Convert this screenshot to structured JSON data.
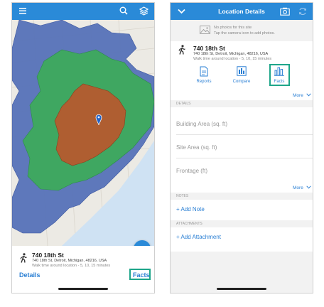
{
  "colors": {
    "accent": "#2a8ad8",
    "highlight": "#1fa68a",
    "link": "#2a7fd4",
    "ring_outer": "#5672b8",
    "ring_middle": "#3daa5c",
    "ring_inner": "#b55a2e",
    "water": "#cfe2f3"
  },
  "left": {
    "appbar": {
      "icons": [
        "menu-icon",
        "search-icon",
        "layers-icon"
      ]
    },
    "fab": {
      "icon": "more-icon"
    },
    "location": {
      "name": "740 18th St",
      "address": "740 18th St, Detroit, Michigan, 48216, USA",
      "walk_time": "Walk time around location - 5, 10, 15 minutes",
      "icon": "walker-icon"
    },
    "links": {
      "details": "Details",
      "facts": "Facts"
    }
  },
  "right": {
    "appbar": {
      "title": "Location Details",
      "icons": [
        "chevron-down-icon",
        "camera-icon",
        "refresh-icon"
      ]
    },
    "photos": {
      "line1": "No photos for this site",
      "line2": "Tap the camera icon to add photos."
    },
    "location": {
      "name": "740 18th St",
      "address": "740 18th St, Detroit, Michigan, 48216, USA",
      "walk_time": "Walk time around location - 5, 10, 15 minutes"
    },
    "actions": [
      {
        "label": "Reports",
        "icon": "document-icon"
      },
      {
        "label": "Compare",
        "icon": "compare-icon"
      },
      {
        "label": "Facts",
        "icon": "bar-chart-icon"
      }
    ],
    "more_label": "More",
    "details": {
      "header": "DETAILS",
      "fields": [
        "Building Area (sq. ft)",
        "Site Area (sq. ft)",
        "Frontage (ft)"
      ],
      "more_label": "More"
    },
    "notes": {
      "header": "NOTES",
      "add_label": "+ Add Note"
    },
    "attachments": {
      "header": "ATTACHMENTS",
      "add_label": "+ Add Attachment"
    }
  }
}
